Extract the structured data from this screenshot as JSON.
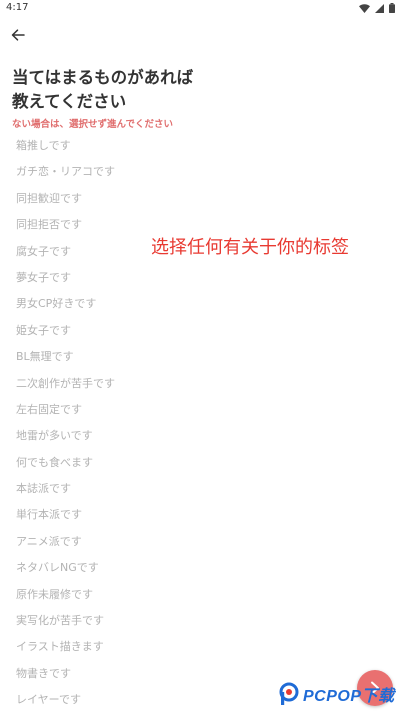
{
  "status_bar": {
    "time": "4:17",
    "icons": [
      "wifi-icon",
      "signal-icon",
      "battery-icon"
    ]
  },
  "header": {
    "back_icon": "arrow-left-icon"
  },
  "prompt": {
    "title_line1": "当てはまるものがあれば",
    "title_line2": "教えてください",
    "note": "ない場合は、選択せず進んでください"
  },
  "options": [
    "箱推しです",
    "ガチ恋・リアコです",
    "同担歓迎です",
    "同担拒否です",
    "腐女子です",
    "夢女子です",
    "男女CP好きです",
    "姫女子です",
    "BL無理です",
    "二次創作が苦手です",
    "左右固定です",
    "地雷が多いです",
    "何でも食べます",
    "本誌派です",
    "単行本派です",
    "アニメ派です",
    "ネタバレNGです",
    "原作未履修です",
    "実写化が苦手です",
    "イラスト描きます",
    "物書きです",
    "レイヤーです"
  ],
  "overlay": {
    "caption": "选择任何有关于你的标签"
  },
  "fab": {
    "icon": "chevron-right-icon"
  },
  "watermark": {
    "text": "PCPOP下载"
  },
  "colors": {
    "accent": "#e97070",
    "note_red": "#e06e6e",
    "option_text": "#b3b3b3",
    "title_text": "#333333",
    "overlay_red": "#e83a32",
    "watermark_blue": "#1f6bd6"
  }
}
